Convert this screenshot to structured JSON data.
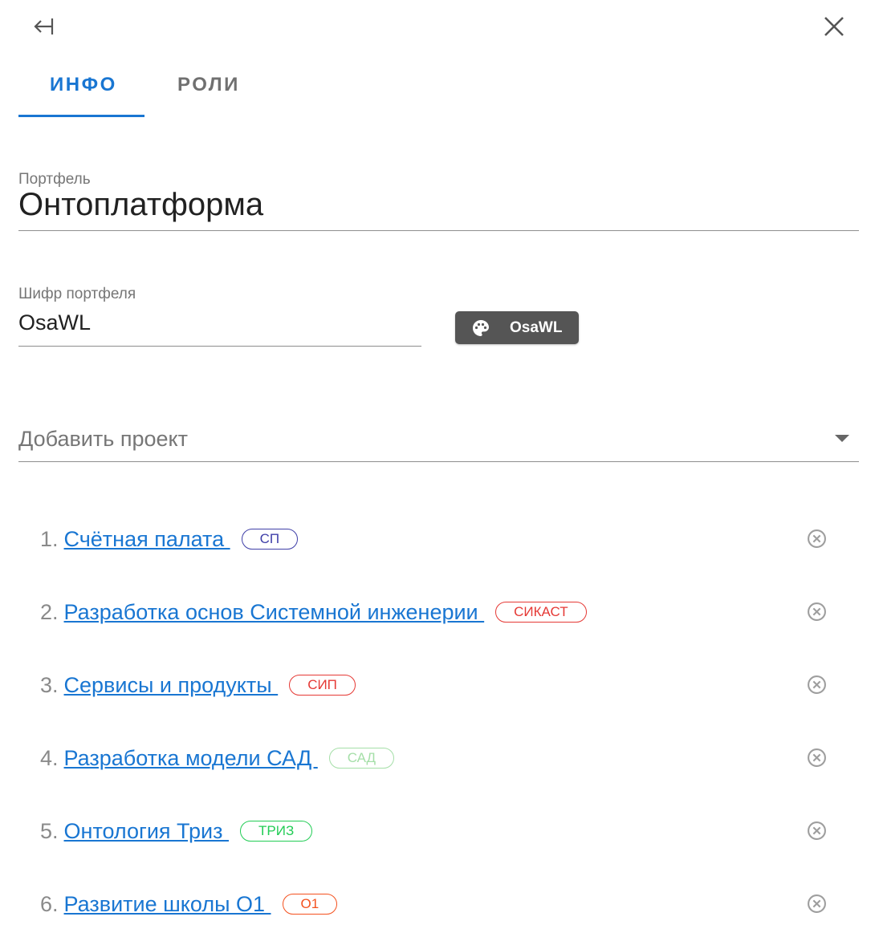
{
  "header": {
    "back_icon": "arrow-left-to-line-icon",
    "close_icon": "close-icon"
  },
  "tabs": [
    {
      "label": "ИНФО",
      "active": true
    },
    {
      "label": "РОЛИ",
      "active": false
    }
  ],
  "portfolio": {
    "label": "Портфель",
    "value": "Онтоплатформа"
  },
  "cipher": {
    "label": "Шифр портфеля",
    "value": "OsaWL",
    "chip_label": "OsaWL",
    "chip_icon": "palette-icon",
    "chip_color": "#555555"
  },
  "add_project": {
    "placeholder": "Добавить проект"
  },
  "colors": {
    "accent": "#1976d2"
  },
  "projects": [
    {
      "num": "1.",
      "name": "Счётная палата ",
      "tag": "СП",
      "tag_color": "#3f3fa8"
    },
    {
      "num": "2.",
      "name": "Разработка основ Системной инженерии ",
      "tag": "СИКАСТ",
      "tag_color": "#e53935"
    },
    {
      "num": "3.",
      "name": "Сервисы и продукты ",
      "tag": "СИП",
      "tag_color": "#e53935"
    },
    {
      "num": "4.",
      "name": "Разработка модели САД ",
      "tag": "САД",
      "tag_color": "#a5dfa8"
    },
    {
      "num": "5.",
      "name": "Онтология Триз ",
      "tag": "ТРИЗ",
      "tag_color": "#22cc55"
    },
    {
      "num": "6.",
      "name": "Развитие школы О1 ",
      "tag": "О1",
      "tag_color": "#f4511e"
    }
  ]
}
